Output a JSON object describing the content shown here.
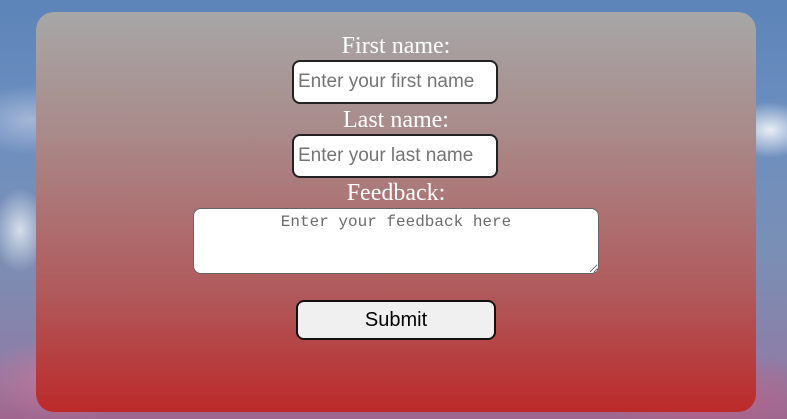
{
  "form": {
    "first_name_label": "First name:",
    "first_name_placeholder": "Enter your first name",
    "last_name_label": "Last name:",
    "last_name_placeholder": "Enter your last name",
    "feedback_label": "Feedback:",
    "feedback_placeholder": "Enter your feedback here",
    "submit_label": "Submit"
  },
  "colors": {
    "card_top": "#a7a7a7",
    "card_bottom": "#bc2a2a",
    "label_text": "#ffffff"
  }
}
